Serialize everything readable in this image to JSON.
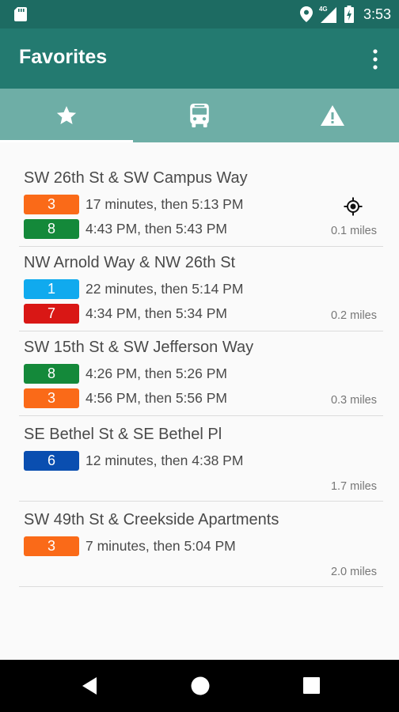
{
  "status_bar": {
    "time": "3:53",
    "network": "4G"
  },
  "app_bar": {
    "title": "Favorites"
  },
  "tabs": [
    {
      "icon": "star-icon",
      "selected": true
    },
    {
      "icon": "bus-icon",
      "selected": false
    },
    {
      "icon": "alert-icon",
      "selected": false
    }
  ],
  "colors": {
    "status_bar": "#1d6b62",
    "app_bar": "#237a70",
    "tab_bar": "#6eaea6",
    "route_orange": "#fa6a18",
    "route_green": "#14893a",
    "route_lightblue": "#10aaee",
    "route_red": "#d91715",
    "route_darkblue": "#0a4eb0"
  },
  "stops": [
    {
      "name": "SW 26th St & SW Campus Way",
      "distance": "0.1 miles",
      "nearest": true,
      "routes": [
        {
          "number": "3",
          "color": "#fa6a18",
          "arrival": "17 minutes, then 5:13 PM"
        },
        {
          "number": "8",
          "color": "#14893a",
          "arrival": "4:43 PM, then 5:43 PM"
        }
      ]
    },
    {
      "name": "NW Arnold Way & NW 26th St",
      "distance": "0.2 miles",
      "routes": [
        {
          "number": "1",
          "color": "#10aaee",
          "arrival": "22 minutes, then 5:14 PM"
        },
        {
          "number": "7",
          "color": "#d91715",
          "arrival": "4:34 PM, then 5:34 PM"
        }
      ]
    },
    {
      "name": "SW 15th St & SW Jefferson Way",
      "distance": "0.3 miles",
      "routes": [
        {
          "number": "8",
          "color": "#14893a",
          "arrival": "4:26 PM, then 5:26 PM"
        },
        {
          "number": "3",
          "color": "#fa6a18",
          "arrival": "4:56 PM, then 5:56 PM"
        }
      ]
    },
    {
      "name": "SE Bethel St & SE Bethel Pl",
      "distance": "1.7 miles",
      "routes": [
        {
          "number": "6",
          "color": "#0a4eb0",
          "arrival": "12 minutes, then 4:38 PM"
        }
      ]
    },
    {
      "name": "SW 49th St & Creekside Apartments",
      "distance": "2.0 miles",
      "routes": [
        {
          "number": "3",
          "color": "#fa6a18",
          "arrival": "7 minutes, then 5:04 PM"
        }
      ]
    }
  ]
}
